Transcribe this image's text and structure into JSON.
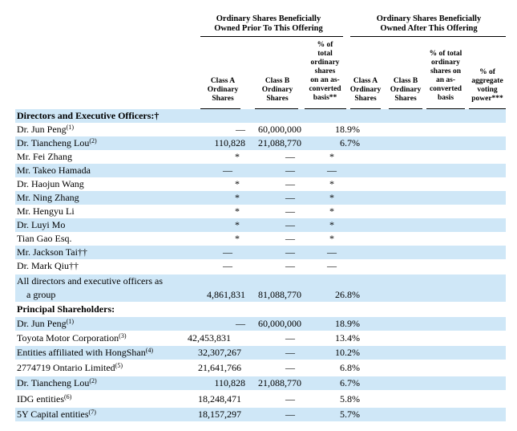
{
  "headers": {
    "prior_group": [
      "Ordinary Shares Beneficially",
      "Owned Prior To This Offering"
    ],
    "after_group": [
      "Ordinary Shares Beneficially",
      "Owned After This Offering"
    ],
    "col_class_a": "Class A\nOrdinary\nShares",
    "col_class_b": "Class B\nOrdinary\nShares",
    "col_pct_prior": "% of\ntotal\nordinary\nshares\non an as-\nconverted\nbasis**",
    "col_class_a_after": "Class A\nOrdinary\nShares",
    "col_class_b_after": "Class B\nOrdinary\nShares",
    "col_pct_after": "% of total\nordinary\nshares on\nan as-\nconverted\nbasis",
    "col_voting": "% of\naggregate\nvoting\npower***"
  },
  "sections": {
    "directors": "Directors and Executive Officers:†",
    "principal": "Principal Shareholders:"
  },
  "directors": [
    {
      "name": "Dr. Jun Peng",
      "note": "(1)",
      "class_a": "—",
      "class_b": "60,000,000",
      "pct": "18.9%"
    },
    {
      "name": "Dr. Tiancheng Lou",
      "note": "(2)",
      "class_a": "110,828",
      "class_b": "21,088,770",
      "pct": "6.7%"
    },
    {
      "name": "Mr. Fei Zhang",
      "note": "",
      "class_a": "*",
      "class_b": "—",
      "pct": "*"
    },
    {
      "name": "Mr. Takeo Hamada",
      "note": "",
      "class_a": "—",
      "class_b": "—",
      "pct": "—"
    },
    {
      "name": "Dr. Haojun Wang",
      "note": "",
      "class_a": "*",
      "class_b": "—",
      "pct": "*"
    },
    {
      "name": "Mr. Ning Zhang",
      "note": "",
      "class_a": "*",
      "class_b": "—",
      "pct": "*"
    },
    {
      "name": "Mr. Hengyu Li",
      "note": "",
      "class_a": "*",
      "class_b": "—",
      "pct": "*"
    },
    {
      "name": "Dr. Luyi Mo",
      "note": "",
      "class_a": "*",
      "class_b": "—",
      "pct": "*"
    },
    {
      "name": "Tian Gao Esq.",
      "note": "",
      "class_a": "*",
      "class_b": "—",
      "pct": "*"
    },
    {
      "name": "Mr. Jackson Tai††",
      "note": "",
      "class_a": "—",
      "class_b": "—",
      "pct": "—"
    },
    {
      "name": "Dr. Mark Qiu††",
      "note": "",
      "class_a": "—",
      "class_b": "—",
      "pct": "—"
    }
  ],
  "group_row": {
    "line1": "All directors and executive officers as",
    "line2": "a group",
    "class_a": "4,861,831",
    "class_b": "81,088,770",
    "pct": "26.8%"
  },
  "principal": [
    {
      "name": "Dr. Jun Peng",
      "note": "(1)",
      "class_a": "—",
      "class_b": "60,000,000",
      "pct": "18.9%"
    },
    {
      "name": "Toyota Motor Corporation",
      "note": "(3)",
      "class_a": "42,453,831",
      "class_b": "—",
      "pct": "13.4%"
    },
    {
      "name": "Entities affiliated with HongShan",
      "note": "(4)",
      "class_a": "32,307,267",
      "class_b": "—",
      "pct": "10.2%"
    },
    {
      "name": "2774719 Ontario Limited",
      "note": "(5)",
      "class_a": "21,641,766",
      "class_b": "—",
      "pct": "6.8%"
    },
    {
      "name": "Dr. Tiancheng Lou",
      "note": "(2)",
      "class_a": "110,828",
      "class_b": "21,088,770",
      "pct": "6.7%"
    },
    {
      "name": "IDG entities",
      "note": "(6)",
      "class_a": "18,248,471",
      "class_b": "—",
      "pct": "5.8%"
    },
    {
      "name": "5Y Capital entities",
      "note": "(7)",
      "class_a": "18,157,297",
      "class_b": "—",
      "pct": "5.7%"
    }
  ]
}
